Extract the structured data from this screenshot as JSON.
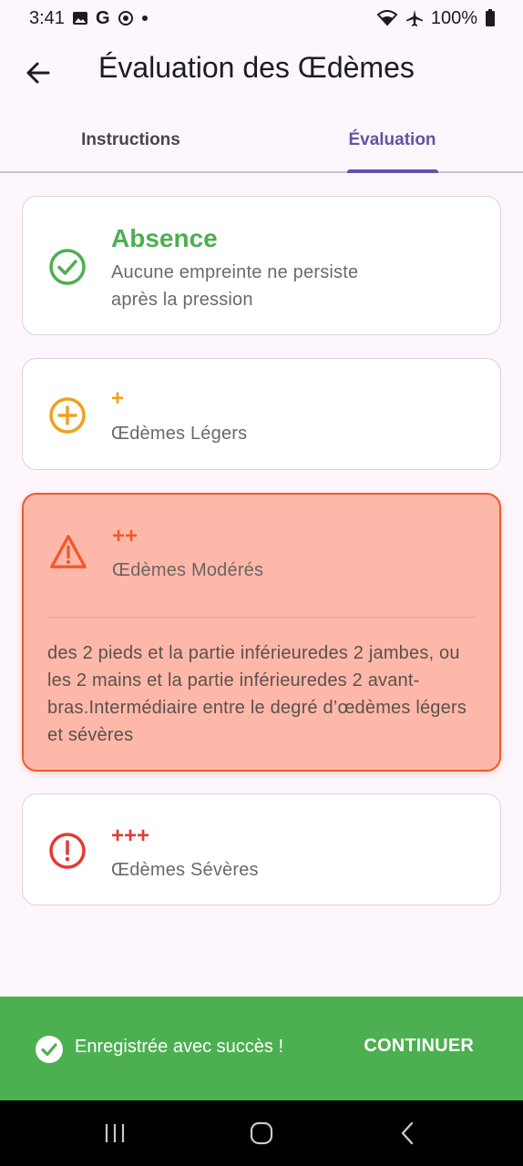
{
  "status_bar": {
    "time": "3:41",
    "battery": "100%"
  },
  "app_bar": {
    "title": "Évaluation des Œdèmes"
  },
  "tabs": [
    {
      "label": "Instructions",
      "active": false
    },
    {
      "label": "Évaluation",
      "active": true
    }
  ],
  "options": [
    {
      "grade": "Absence",
      "description": "Aucune empreinte ne persiste\n après la pression",
      "color": "#4caf50",
      "icon": "check-circle-icon",
      "selected": false
    },
    {
      "grade": "+",
      "description": "Œdèmes Légers",
      "color": "#f0a020",
      "icon": "plus-circle-icon",
      "selected": false
    },
    {
      "grade": "++",
      "description": "Œdèmes Modérés",
      "color": "#ee5a2c",
      "icon": "warning-triangle-icon",
      "selected": true,
      "details": "des 2 pieds et la partie inférieuredes 2 jambes, ou les 2 mains et la partie inférieuredes 2 avant-bras.Intermédiaire entre le degré d’œdèmes légers et sévères"
    },
    {
      "grade": "+++",
      "description": "Œdèmes Sévères",
      "color": "#e53935",
      "icon": "alert-circle-icon",
      "selected": false
    }
  ],
  "snackbar": {
    "message": "Enregistrée avec succès !",
    "action": "CONTINUER",
    "color": "#4caf50"
  }
}
